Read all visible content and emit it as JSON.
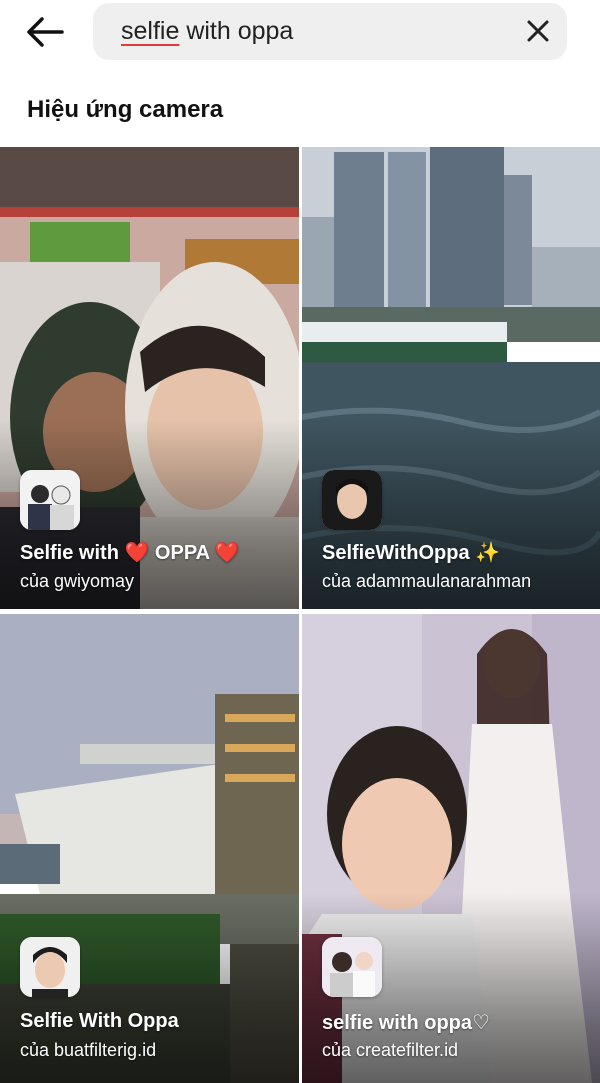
{
  "search": {
    "query_underlined": "selfie",
    "query_rest": " with oppa"
  },
  "section": {
    "title": "Hiệu ứng camera"
  },
  "effects": [
    {
      "title": "Selfie with ❤️ OPPA ❤️",
      "author": "của gwiyomay"
    },
    {
      "title": "SelfieWithOppa ✨",
      "author": "của adammaulanarahman"
    },
    {
      "title": "Selfie With Oppa",
      "author": "của buatfilterig.id"
    },
    {
      "title": "selfie with oppa♡",
      "author": "của createfilter.id"
    }
  ],
  "colors": {
    "accent_underline": "#e53935",
    "heart": "#e53935",
    "search_bg": "#efefef"
  },
  "icons": [
    "back-arrow-icon",
    "close-icon"
  ]
}
